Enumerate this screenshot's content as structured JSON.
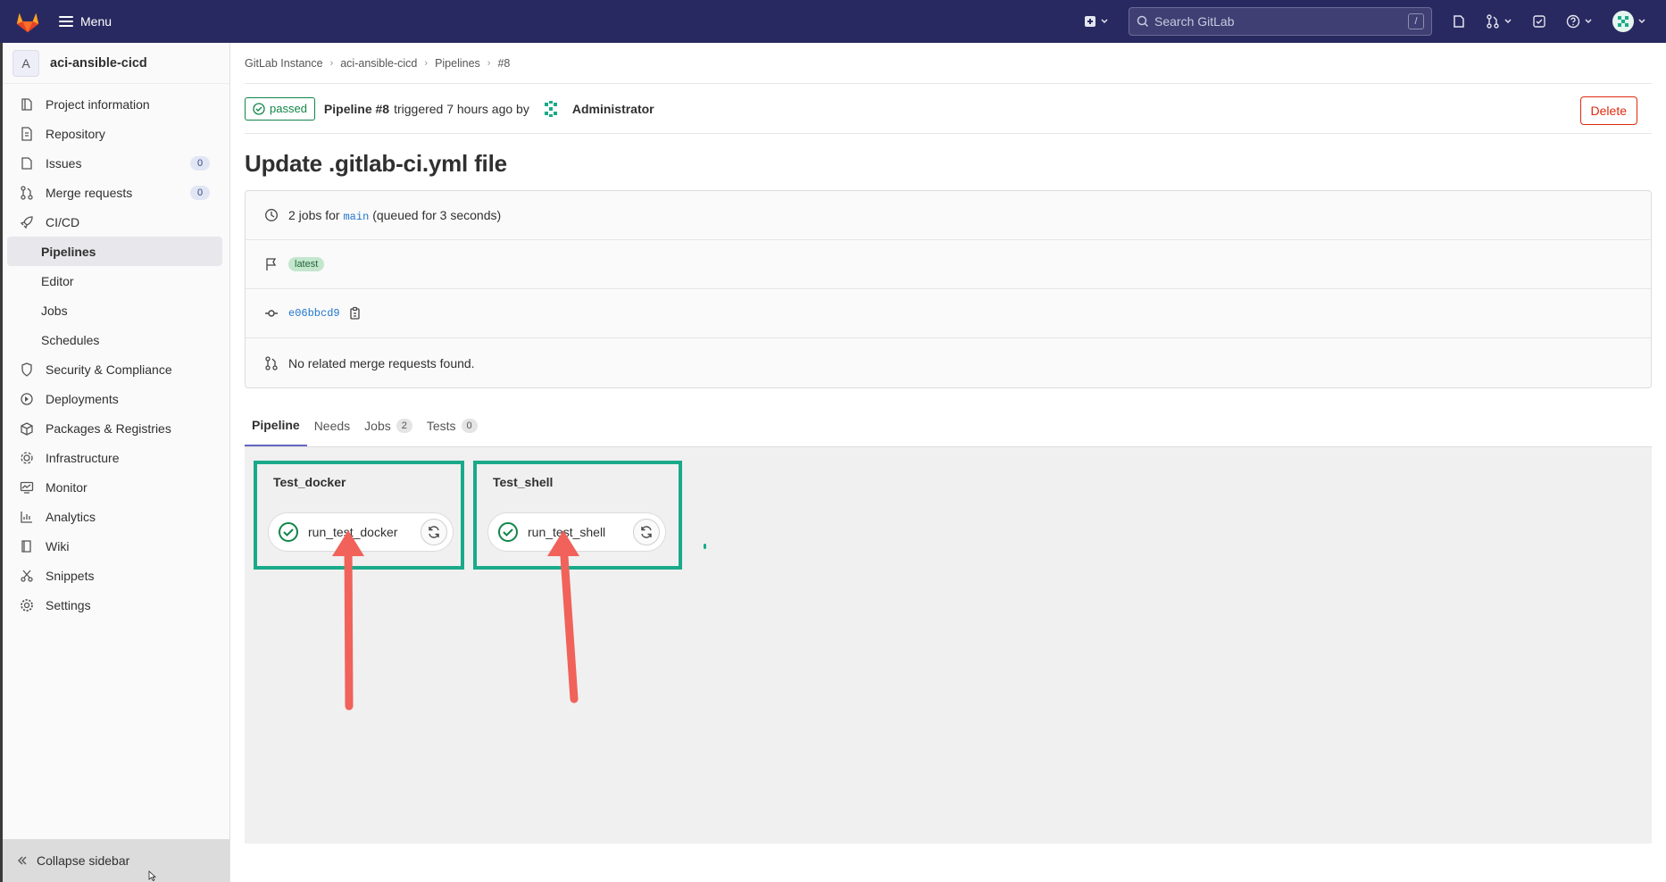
{
  "topbar": {
    "menu_label": "Menu",
    "search_placeholder": "Search GitLab",
    "search_shortcut": "/"
  },
  "sidebar": {
    "project_initial": "A",
    "project_name": "aci-ansible-cicd",
    "items": [
      {
        "label": "Project information",
        "icon": "project-icon"
      },
      {
        "label": "Repository",
        "icon": "doc-icon"
      },
      {
        "label": "Issues",
        "icon": "issues-icon",
        "count": "0"
      },
      {
        "label": "Merge requests",
        "icon": "merge-icon",
        "count": "0"
      },
      {
        "label": "CI/CD",
        "icon": "rocket-icon"
      },
      {
        "label": "Pipelines",
        "sub": true,
        "active": true
      },
      {
        "label": "Editor",
        "sub": true
      },
      {
        "label": "Jobs",
        "sub": true
      },
      {
        "label": "Schedules",
        "sub": true
      },
      {
        "label": "Security & Compliance",
        "icon": "shield-icon"
      },
      {
        "label": "Deployments",
        "icon": "deploy-icon"
      },
      {
        "label": "Packages & Registries",
        "icon": "package-icon"
      },
      {
        "label": "Infrastructure",
        "icon": "cloud-gear-icon"
      },
      {
        "label": "Monitor",
        "icon": "monitor-icon"
      },
      {
        "label": "Analytics",
        "icon": "chart-icon"
      },
      {
        "label": "Wiki",
        "icon": "book-icon"
      },
      {
        "label": "Snippets",
        "icon": "scissors-icon"
      },
      {
        "label": "Settings",
        "icon": "gear-icon"
      }
    ],
    "collapse_label": "Collapse sidebar"
  },
  "breadcrumb": [
    "GitLab Instance",
    "aci-ansible-cicd",
    "Pipelines",
    "#8"
  ],
  "pipeline": {
    "status": "passed",
    "label": "Pipeline #8",
    "triggered_text": "triggered 7 hours ago by",
    "user": "Administrator",
    "delete_label": "Delete",
    "title": "Update .gitlab-ci.yml file",
    "jobs_prefix": "2 jobs for",
    "branch": "main",
    "queued_text": "(queued for 3 seconds)",
    "tag": "latest",
    "commit": "e06bbcd9",
    "merge_text": "No related merge requests found."
  },
  "tabs": [
    {
      "label": "Pipeline",
      "active": true
    },
    {
      "label": "Needs"
    },
    {
      "label": "Jobs",
      "count": "2"
    },
    {
      "label": "Tests",
      "count": "0"
    }
  ],
  "stages": [
    {
      "name": "Test_docker",
      "job": "run_test_docker"
    },
    {
      "name": "Test_shell",
      "job": "run_test_shell"
    }
  ],
  "colors": {
    "topbar": "#292961",
    "success": "#108548",
    "highlight": "#1aaa8a",
    "arrow": "#f0625a",
    "delete": "#dd2b0e"
  }
}
